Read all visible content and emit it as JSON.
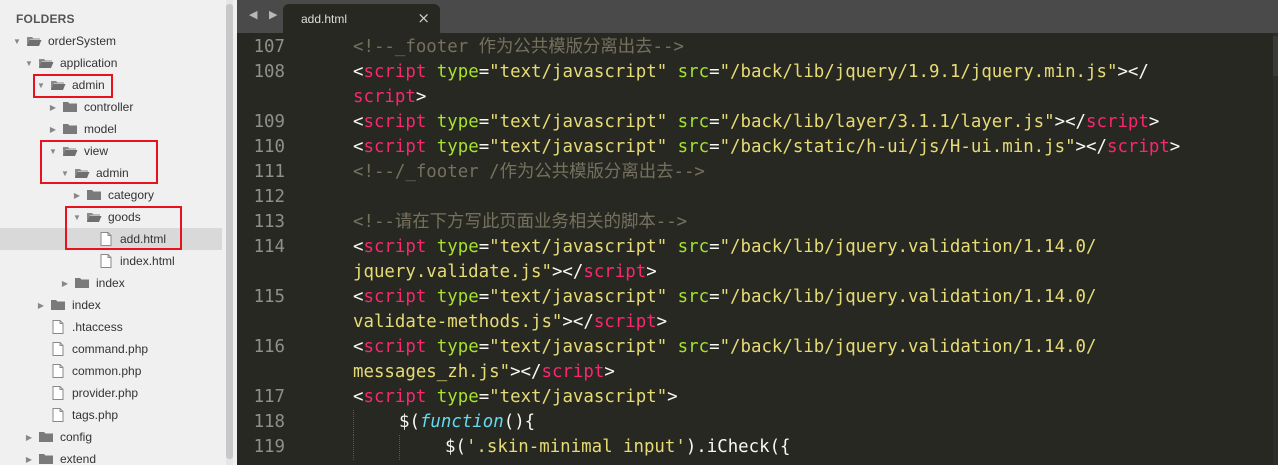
{
  "sidebar": {
    "header": "FOLDERS",
    "items": [
      {
        "label": "orderSystem",
        "type": "folder",
        "open": true,
        "depth": 0,
        "selected": false
      },
      {
        "label": "application",
        "type": "folder",
        "open": true,
        "depth": 1,
        "selected": false
      },
      {
        "label": "admin",
        "type": "folder",
        "open": true,
        "depth": 2,
        "selected": false
      },
      {
        "label": "controller",
        "type": "folder",
        "open": false,
        "depth": 3,
        "selected": false
      },
      {
        "label": "model",
        "type": "folder",
        "open": false,
        "depth": 3,
        "selected": false
      },
      {
        "label": "view",
        "type": "folder",
        "open": true,
        "depth": 3,
        "selected": false
      },
      {
        "label": "admin",
        "type": "folder",
        "open": true,
        "depth": 4,
        "selected": false
      },
      {
        "label": "category",
        "type": "folder",
        "open": false,
        "depth": 5,
        "selected": false
      },
      {
        "label": "goods",
        "type": "folder",
        "open": true,
        "depth": 5,
        "selected": false
      },
      {
        "label": "add.html",
        "type": "file",
        "depth": 6,
        "selected": true
      },
      {
        "label": "index.html",
        "type": "file",
        "depth": 6,
        "selected": false
      },
      {
        "label": "index",
        "type": "folder",
        "open": false,
        "depth": 4,
        "selected": false
      },
      {
        "label": "index",
        "type": "folder",
        "open": false,
        "depth": 2,
        "selected": false
      },
      {
        "label": ".htaccess",
        "type": "file",
        "depth": 2,
        "selected": false
      },
      {
        "label": "command.php",
        "type": "file",
        "depth": 2,
        "selected": false
      },
      {
        "label": "common.php",
        "type": "file",
        "depth": 2,
        "selected": false
      },
      {
        "label": "provider.php",
        "type": "file",
        "depth": 2,
        "selected": false
      },
      {
        "label": "tags.php",
        "type": "file",
        "depth": 2,
        "selected": false
      },
      {
        "label": "config",
        "type": "folder",
        "open": false,
        "depth": 1,
        "selected": false
      },
      {
        "label": "extend",
        "type": "folder",
        "open": false,
        "depth": 1,
        "selected": false
      }
    ]
  },
  "tabs": {
    "nav": "◀ ▶",
    "active": {
      "label": "add.html",
      "close": "×"
    }
  },
  "colors": {
    "highlight_box": "#e8121d",
    "comment": "#75715e",
    "tag": "#f92672",
    "attribute": "#a6e22e",
    "string": "#e6db74",
    "plain": "#f8f8f2",
    "keyword_italic": "#66d9ef"
  },
  "code": {
    "lines": [
      {
        "num": "107",
        "indent": 1,
        "tokens": [
          {
            "c": "c",
            "t": "<!--_footer 作为公共模版分离出去-->"
          }
        ]
      },
      {
        "num": "108",
        "indent": 1,
        "tokens": [
          {
            "c": "p",
            "t": "<"
          },
          {
            "c": "t",
            "t": "script"
          },
          {
            "c": "p",
            "t": " "
          },
          {
            "c": "a",
            "t": "type"
          },
          {
            "c": "p",
            "t": "="
          },
          {
            "c": "s",
            "t": "\"text/javascript\""
          },
          {
            "c": "p",
            "t": " "
          },
          {
            "c": "a",
            "t": "src"
          },
          {
            "c": "p",
            "t": "="
          },
          {
            "c": "s",
            "t": "\"/back/lib/jquery/1.9.1/jquery.min.js\""
          },
          {
            "c": "p",
            "t": "></"
          }
        ]
      },
      {
        "num": "",
        "indent": 1,
        "tokens": [
          {
            "c": "t",
            "t": "script"
          },
          {
            "c": "p",
            "t": ">"
          }
        ]
      },
      {
        "num": "109",
        "indent": 1,
        "tokens": [
          {
            "c": "p",
            "t": "<"
          },
          {
            "c": "t",
            "t": "script"
          },
          {
            "c": "p",
            "t": " "
          },
          {
            "c": "a",
            "t": "type"
          },
          {
            "c": "p",
            "t": "="
          },
          {
            "c": "s",
            "t": "\"text/javascript\""
          },
          {
            "c": "p",
            "t": " "
          },
          {
            "c": "a",
            "t": "src"
          },
          {
            "c": "p",
            "t": "="
          },
          {
            "c": "s",
            "t": "\"/back/lib/layer/3.1.1/layer.js\""
          },
          {
            "c": "p",
            "t": "></"
          },
          {
            "c": "t",
            "t": "script"
          },
          {
            "c": "p",
            "t": ">"
          }
        ]
      },
      {
        "num": "110",
        "indent": 1,
        "tokens": [
          {
            "c": "p",
            "t": "<"
          },
          {
            "c": "t",
            "t": "script"
          },
          {
            "c": "p",
            "t": " "
          },
          {
            "c": "a",
            "t": "type"
          },
          {
            "c": "p",
            "t": "="
          },
          {
            "c": "s",
            "t": "\"text/javascript\""
          },
          {
            "c": "p",
            "t": " "
          },
          {
            "c": "a",
            "t": "src"
          },
          {
            "c": "p",
            "t": "="
          },
          {
            "c": "s",
            "t": "\"/back/static/h-ui/js/H-ui.min.js\""
          },
          {
            "c": "p",
            "t": "></"
          },
          {
            "c": "t",
            "t": "script"
          },
          {
            "c": "p",
            "t": ">"
          }
        ]
      },
      {
        "num": "111",
        "indent": 1,
        "tokens": [
          {
            "c": "c",
            "t": "<!--/_footer /作为公共模版分离出去-->"
          }
        ]
      },
      {
        "num": "112",
        "indent": 1,
        "tokens": []
      },
      {
        "num": "113",
        "indent": 1,
        "tokens": [
          {
            "c": "c",
            "t": "<!--请在下方写此页面业务相关的脚本-->"
          }
        ]
      },
      {
        "num": "114",
        "indent": 1,
        "tokens": [
          {
            "c": "p",
            "t": "<"
          },
          {
            "c": "t",
            "t": "script"
          },
          {
            "c": "p",
            "t": " "
          },
          {
            "c": "a",
            "t": "type"
          },
          {
            "c": "p",
            "t": "="
          },
          {
            "c": "s",
            "t": "\"text/javascript\""
          },
          {
            "c": "p",
            "t": " "
          },
          {
            "c": "a",
            "t": "src"
          },
          {
            "c": "p",
            "t": "="
          },
          {
            "c": "s",
            "t": "\"/back/lib/jquery.validation/1.14.0/"
          }
        ]
      },
      {
        "num": "",
        "indent": 1,
        "tokens": [
          {
            "c": "s",
            "t": "jquery.validate.js\""
          },
          {
            "c": "p",
            "t": "></"
          },
          {
            "c": "t",
            "t": "script"
          },
          {
            "c": "p",
            "t": ">"
          }
        ]
      },
      {
        "num": "115",
        "indent": 1,
        "tokens": [
          {
            "c": "p",
            "t": "<"
          },
          {
            "c": "t",
            "t": "script"
          },
          {
            "c": "p",
            "t": " "
          },
          {
            "c": "a",
            "t": "type"
          },
          {
            "c": "p",
            "t": "="
          },
          {
            "c": "s",
            "t": "\"text/javascript\""
          },
          {
            "c": "p",
            "t": " "
          },
          {
            "c": "a",
            "t": "src"
          },
          {
            "c": "p",
            "t": "="
          },
          {
            "c": "s",
            "t": "\"/back/lib/jquery.validation/1.14.0/"
          }
        ]
      },
      {
        "num": "",
        "indent": 1,
        "tokens": [
          {
            "c": "s",
            "t": "validate-methods.js\""
          },
          {
            "c": "p",
            "t": "></"
          },
          {
            "c": "t",
            "t": "script"
          },
          {
            "c": "p",
            "t": ">"
          }
        ]
      },
      {
        "num": "116",
        "indent": 1,
        "tokens": [
          {
            "c": "p",
            "t": "<"
          },
          {
            "c": "t",
            "t": "script"
          },
          {
            "c": "p",
            "t": " "
          },
          {
            "c": "a",
            "t": "type"
          },
          {
            "c": "p",
            "t": "="
          },
          {
            "c": "s",
            "t": "\"text/javascript\""
          },
          {
            "c": "p",
            "t": " "
          },
          {
            "c": "a",
            "t": "src"
          },
          {
            "c": "p",
            "t": "="
          },
          {
            "c": "s",
            "t": "\"/back/lib/jquery.validation/1.14.0/"
          }
        ]
      },
      {
        "num": "",
        "indent": 1,
        "tokens": [
          {
            "c": "s",
            "t": "messages_zh.js\""
          },
          {
            "c": "p",
            "t": "></"
          },
          {
            "c": "t",
            "t": "script"
          },
          {
            "c": "p",
            "t": ">"
          }
        ]
      },
      {
        "num": "117",
        "indent": 1,
        "tokens": [
          {
            "c": "p",
            "t": "<"
          },
          {
            "c": "t",
            "t": "script"
          },
          {
            "c": "p",
            "t": " "
          },
          {
            "c": "a",
            "t": "type"
          },
          {
            "c": "p",
            "t": "="
          },
          {
            "c": "s",
            "t": "\"text/javascript\""
          },
          {
            "c": "p",
            "t": ">"
          }
        ]
      },
      {
        "num": "118",
        "indent": 2,
        "tokens": [
          {
            "c": "p",
            "t": "$("
          },
          {
            "c": "f",
            "t": "function"
          },
          {
            "c": "p",
            "t": "(){"
          }
        ]
      },
      {
        "num": "119",
        "indent": 3,
        "tokens": [
          {
            "c": "p",
            "t": "$("
          },
          {
            "c": "s",
            "t": "'.skin-minimal input'"
          },
          {
            "c": "p",
            "t": ").iCheck({"
          }
        ]
      }
    ]
  }
}
